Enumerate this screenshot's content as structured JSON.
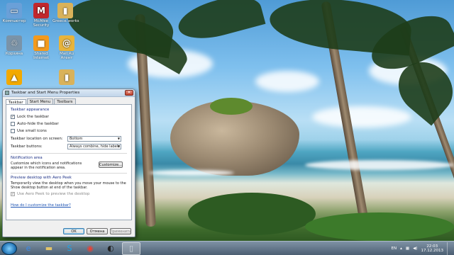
{
  "desktop_icons": [
    {
      "label": "Компьютер",
      "glyph": "▭",
      "color": "#6aa0d8"
    },
    {
      "label": "McAfee Security",
      "glyph": "M",
      "color": "#c1272d"
    },
    {
      "label": "Greece.works",
      "glyph": "▮",
      "color": "#d9b25a"
    },
    {
      "label": "Корзина",
      "glyph": "♲",
      "color": "#7a93a8"
    },
    {
      "label": "Shared Internet",
      "glyph": "■",
      "color": "#f39a1e"
    },
    {
      "label": "Mail.Ru Агент",
      "glyph": "@",
      "color": "#e8b43c"
    },
    {
      "label": "",
      "glyph": "▲",
      "color": "#f2a900"
    },
    {
      "label": "",
      "glyph": "▮",
      "color": "#d9b25a"
    }
  ],
  "dialog": {
    "title": "Taskbar and Start Menu Properties",
    "close": "✕",
    "tabs": [
      "Taskbar",
      "Start Menu",
      "Toolbars"
    ],
    "appearance": {
      "heading": "Taskbar appearance",
      "lock": {
        "label": "Lock the taskbar",
        "checked": "✓"
      },
      "autohide": {
        "label": "Auto-hide the taskbar",
        "checked": ""
      },
      "small_icons": {
        "label": "Use small icons",
        "checked": ""
      },
      "location_label": "Taskbar location on screen:",
      "location_value": "Bottom",
      "buttons_label": "Taskbar buttons:",
      "buttons_value": "Always combine, hide labels"
    },
    "notification": {
      "heading": "Notification area",
      "desc": "Customize which icons and notifications appear in the notification area.",
      "button": "Customize..."
    },
    "peek": {
      "heading": "Preview desktop with Aero Peek",
      "desc": "Temporarily view the desktop when you move your mouse to the Show desktop button at end of the taskbar.",
      "checkbox": "Use Aero Peek to preview the desktop",
      "checked": "✓"
    },
    "help_link": "How do I customize the taskbar?",
    "ok": "OK",
    "cancel": "Отмена",
    "apply": "Применить"
  },
  "taskbar": {
    "items": [
      {
        "name": "ie-icon",
        "glyph": "e",
        "color": "#3b8be8"
      },
      {
        "name": "explorer-icon",
        "glyph": "▬",
        "color": "#e3c56a"
      },
      {
        "name": "skype-icon",
        "glyph": "S",
        "color": "#1ea4e6"
      },
      {
        "name": "chrome-icon",
        "glyph": "◉",
        "color": "#e94235"
      },
      {
        "name": "obs-icon",
        "glyph": "◐",
        "color": "#222"
      },
      {
        "name": "taskbar-properties-icon",
        "glyph": "▯",
        "color": "#cfd8e0"
      }
    ],
    "language": "EN",
    "time": "22:03",
    "date": "17.12.2013"
  }
}
